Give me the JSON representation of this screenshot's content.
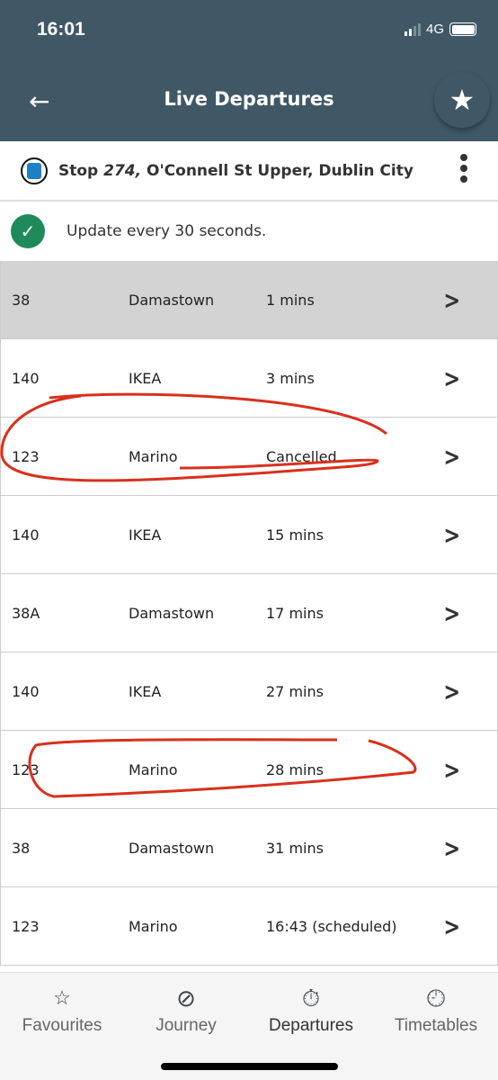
{
  "status_bar": {
    "time": "16:01",
    "network": "4G"
  },
  "header": {
    "title": "Live Departures",
    "back_icon": "arrow-left-icon",
    "favourite_icon": "star-icon"
  },
  "stop": {
    "prefix": "Stop",
    "number": "274,",
    "name": "O'Connell St Upper, Dublin City"
  },
  "update": {
    "text": "Update every 30 seconds."
  },
  "departures": [
    {
      "route": "38",
      "destination": "Damastown",
      "time": "1 mins"
    },
    {
      "route": "140",
      "destination": "IKEA",
      "time": "3 mins"
    },
    {
      "route": "123",
      "destination": "Marino",
      "time": "Cancelled"
    },
    {
      "route": "140",
      "destination": "IKEA",
      "time": "15 mins"
    },
    {
      "route": "38A",
      "destination": "Damastown",
      "time": "17 mins"
    },
    {
      "route": "140",
      "destination": "IKEA",
      "time": "27 mins"
    },
    {
      "route": "123",
      "destination": "Marino",
      "time": "28 mins"
    },
    {
      "route": "38",
      "destination": "Damastown",
      "time": "31 mins"
    },
    {
      "route": "123",
      "destination": "Marino",
      "time": "16:43 (scheduled)"
    }
  ],
  "tabs": [
    {
      "label": "Favourites"
    },
    {
      "label": "Journey"
    },
    {
      "label": "Departures"
    },
    {
      "label": "Timetables"
    }
  ],
  "colors": {
    "header": "#405866",
    "annotation": "#d9301c",
    "check": "#1e8a5a"
  }
}
